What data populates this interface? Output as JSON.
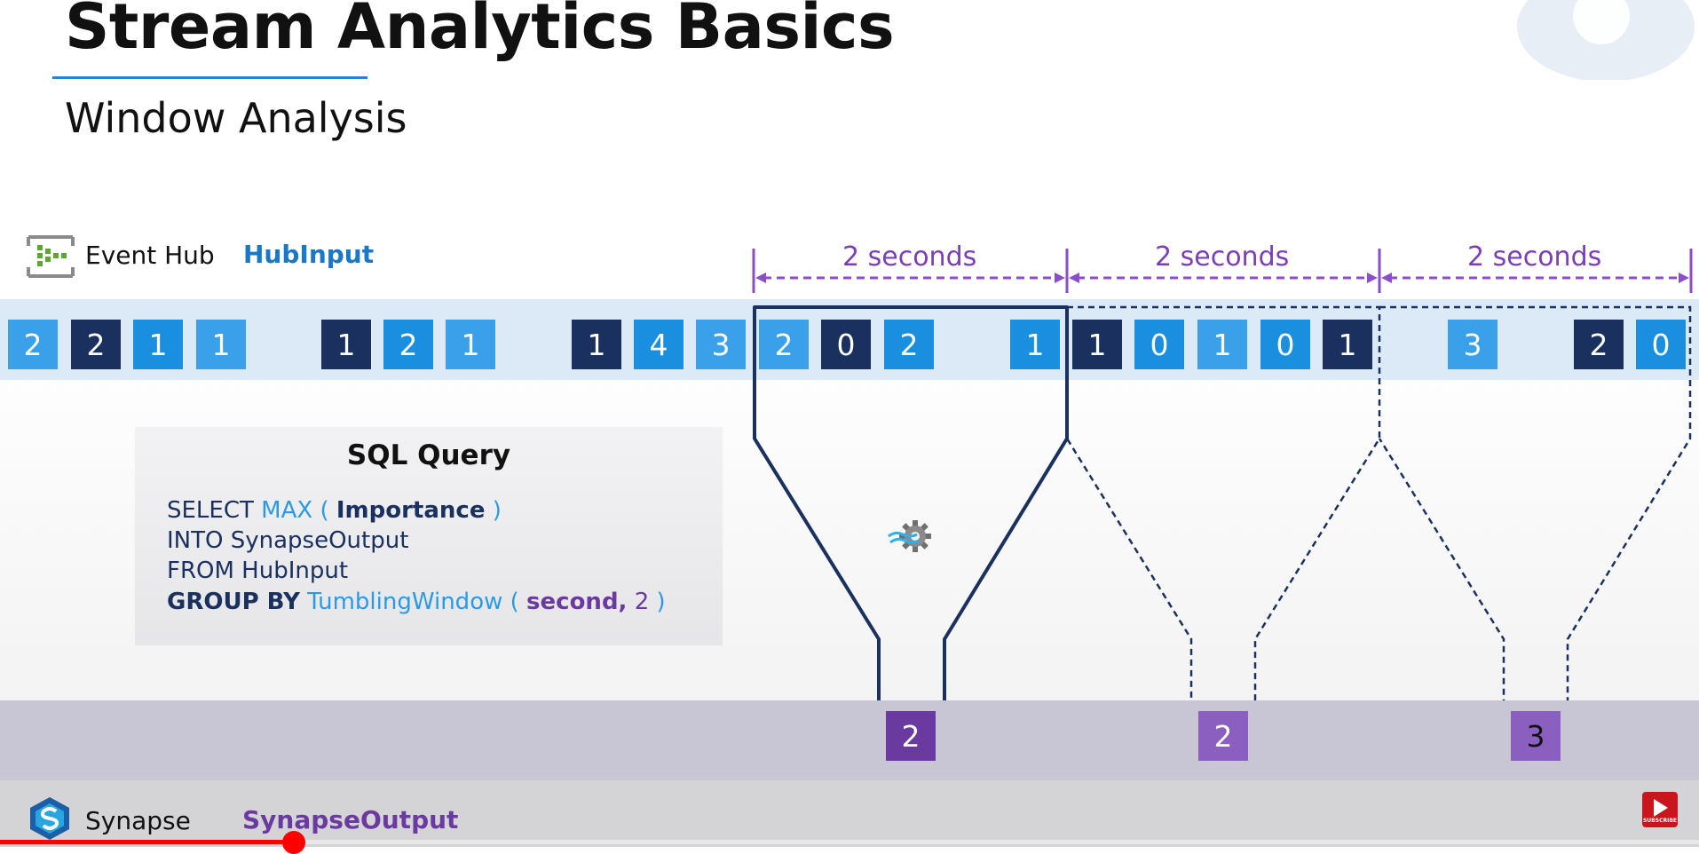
{
  "slide": {
    "title": "Stream Analytics Basics",
    "subtitle": "Window Analysis"
  },
  "input": {
    "service": "Event Hub",
    "name": "HubInput",
    "values": [
      "2",
      "2",
      "1",
      "1",
      "1",
      "2",
      "1",
      "1",
      "4",
      "3",
      "2",
      "0",
      "2",
      "1",
      "1",
      "0",
      "1",
      "0",
      "1",
      "3",
      "2",
      "0"
    ]
  },
  "windows": [
    {
      "label": "2 seconds",
      "result": "2"
    },
    {
      "label": "2 seconds",
      "result": "2"
    },
    {
      "label": "2 seconds",
      "result": "3"
    }
  ],
  "query": {
    "title": "SQL Query",
    "line1": {
      "kw": "SELECT",
      "fn": "MAX (",
      "arg": "Importance",
      "close": ")"
    },
    "line2": "INTO SynapseOutput",
    "line3": "FROM HubInput",
    "line4": {
      "kw": "GROUP BY",
      "fn": "TumblingWindow (",
      "arg": "second,",
      "num": "2",
      "close": ")"
    }
  },
  "output": {
    "service": "Synapse",
    "name": "SynapseOutput"
  },
  "colors": {
    "accent_blue": "#2a7fd4",
    "event_dark": "#1a3160",
    "event_blue": "#1a8fe0",
    "event_light": "#3aa0ea",
    "window_purple": "#8a4fc8",
    "output_purple": "#6b3aa0",
    "progress_red": "#ff0000"
  },
  "icons": {
    "event_hub": "event-hub-icon",
    "synapse": "synapse-icon",
    "stream_job": "stream-analytics-gear-icon",
    "subscribe": "subscribe-icon"
  },
  "player": {
    "subscribe_label": "SUBSCRIBE"
  }
}
